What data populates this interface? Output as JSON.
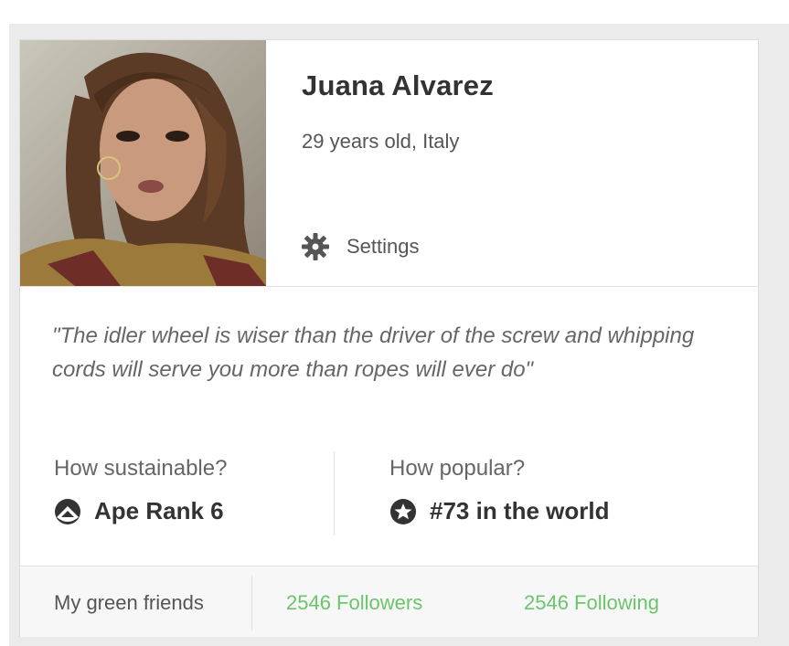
{
  "profile": {
    "name": "Juana Alvarez",
    "meta": "29 years old, Italy",
    "settings_label": "Settings",
    "quote": "\"The idler wheel is wiser than the driver of the screw and whipping cords will serve you more than ropes will ever do\""
  },
  "stats": {
    "sustainable": {
      "label": "How sustainable?",
      "value": "Ape Rank 6",
      "icon": "ape-rank-icon"
    },
    "popular": {
      "label": "How popular?",
      "value": "#73 in the world",
      "icon": "star-badge-icon"
    }
  },
  "footer": {
    "label": "My green friends",
    "followers": "2546 Followers",
    "following": "2546 Following"
  },
  "colors": {
    "accent_green": "#6cc46c",
    "text_dark": "#333333",
    "text_muted": "#666666",
    "frame_gray": "#ebebeb"
  }
}
